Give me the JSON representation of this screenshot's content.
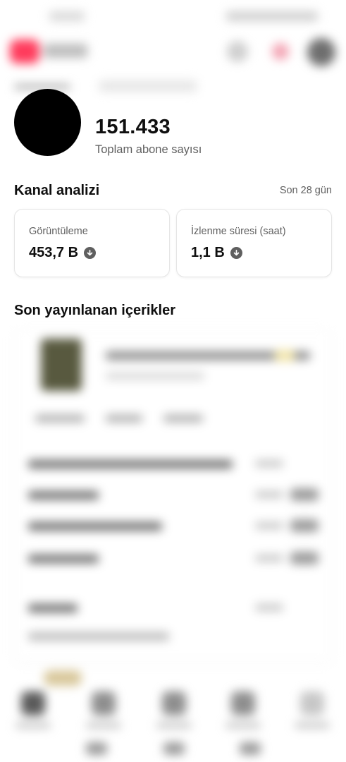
{
  "profile": {
    "subscriber_count": "151.433",
    "subscriber_label": "Toplam abone sayısı"
  },
  "analytics": {
    "title": "Kanal analizi",
    "period": "Son 28 gün",
    "metrics": [
      {
        "label": "Görüntüleme",
        "value": "453,7 B",
        "trend": "down"
      },
      {
        "label": "İzlenme süresi (saat)",
        "value": "1,1 B",
        "trend": "down"
      }
    ]
  },
  "recent": {
    "title": "Son yayınlanan içerikler"
  },
  "icons": {
    "trend": "arrow-down-circle-icon"
  },
  "colors": {
    "text_primary": "#0f0f0f",
    "text_secondary": "#606060",
    "brand": "#ff3b5c"
  }
}
